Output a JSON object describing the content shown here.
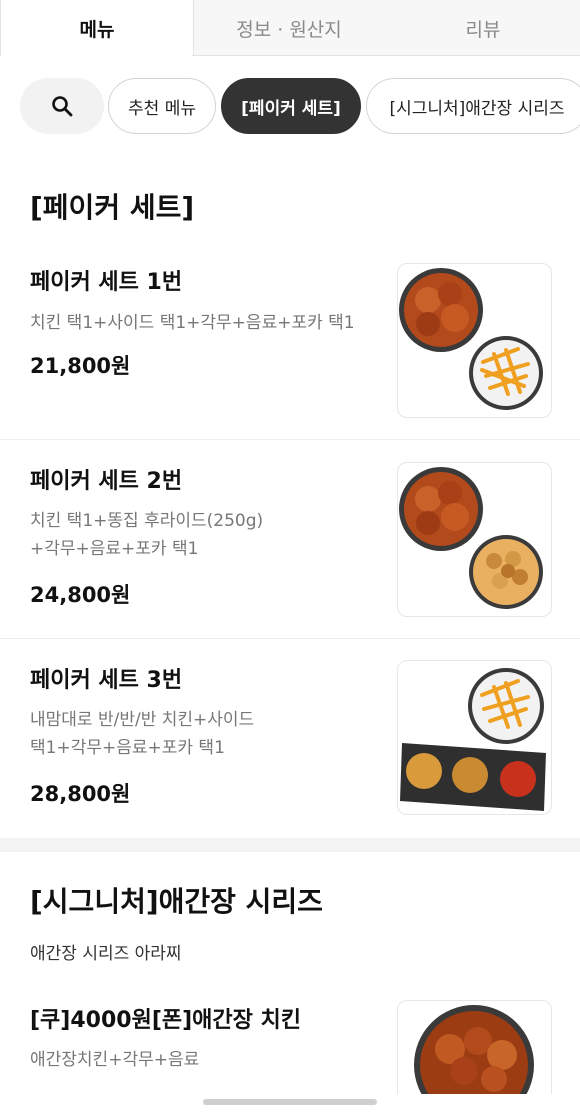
{
  "tabs": [
    {
      "label": "메뉴",
      "active": true
    },
    {
      "label": "정보 · 원산지",
      "active": false
    },
    {
      "label": "리뷰",
      "active": false
    }
  ],
  "chips": {
    "search_icon": "search-icon",
    "items": [
      {
        "label": "추천 메뉴",
        "active": false
      },
      {
        "label": "[페이커 세트]",
        "active": true
      },
      {
        "label": "[시그니처]애간장 시리즈",
        "active": false
      }
    ]
  },
  "sections": [
    {
      "title": "[페이커 세트]",
      "items": [
        {
          "name": "페이커 세트 1번",
          "desc_lines": [
            "치킨 택1+사이드 택1+각무+음료+포카 택1"
          ],
          "price": "21,800원",
          "image": "fried-chicken-and-fries"
        },
        {
          "name": "페이커 세트 2번",
          "desc_lines": [
            "치킨 택1+똥집 후라이드(250g)",
            "+각무+음료+포카 택1"
          ],
          "price": "24,800원",
          "image": "fried-chicken-and-gizzards"
        },
        {
          "name": "페이커 세트 3번",
          "desc_lines": [
            "내맘대로 반/반/반 치킨+사이드",
            "택1+각무+음료+포카 택1"
          ],
          "price": "28,800원",
          "image": "fries-and-three-chicken-plates"
        }
      ]
    },
    {
      "title": "[시그니처]애간장 시리즈",
      "subtitle": "애간장 시리즈 아라찌",
      "items": [
        {
          "name": "[쿠]4000원[폰]애간장 치킨",
          "desc_lines": [
            "애간장치킨+각무+음료"
          ],
          "image": "soy-glazed-chicken"
        }
      ]
    }
  ],
  "colors": {
    "active_chip": "#333333",
    "muted_text": "#777777",
    "divider": "#ececec"
  }
}
